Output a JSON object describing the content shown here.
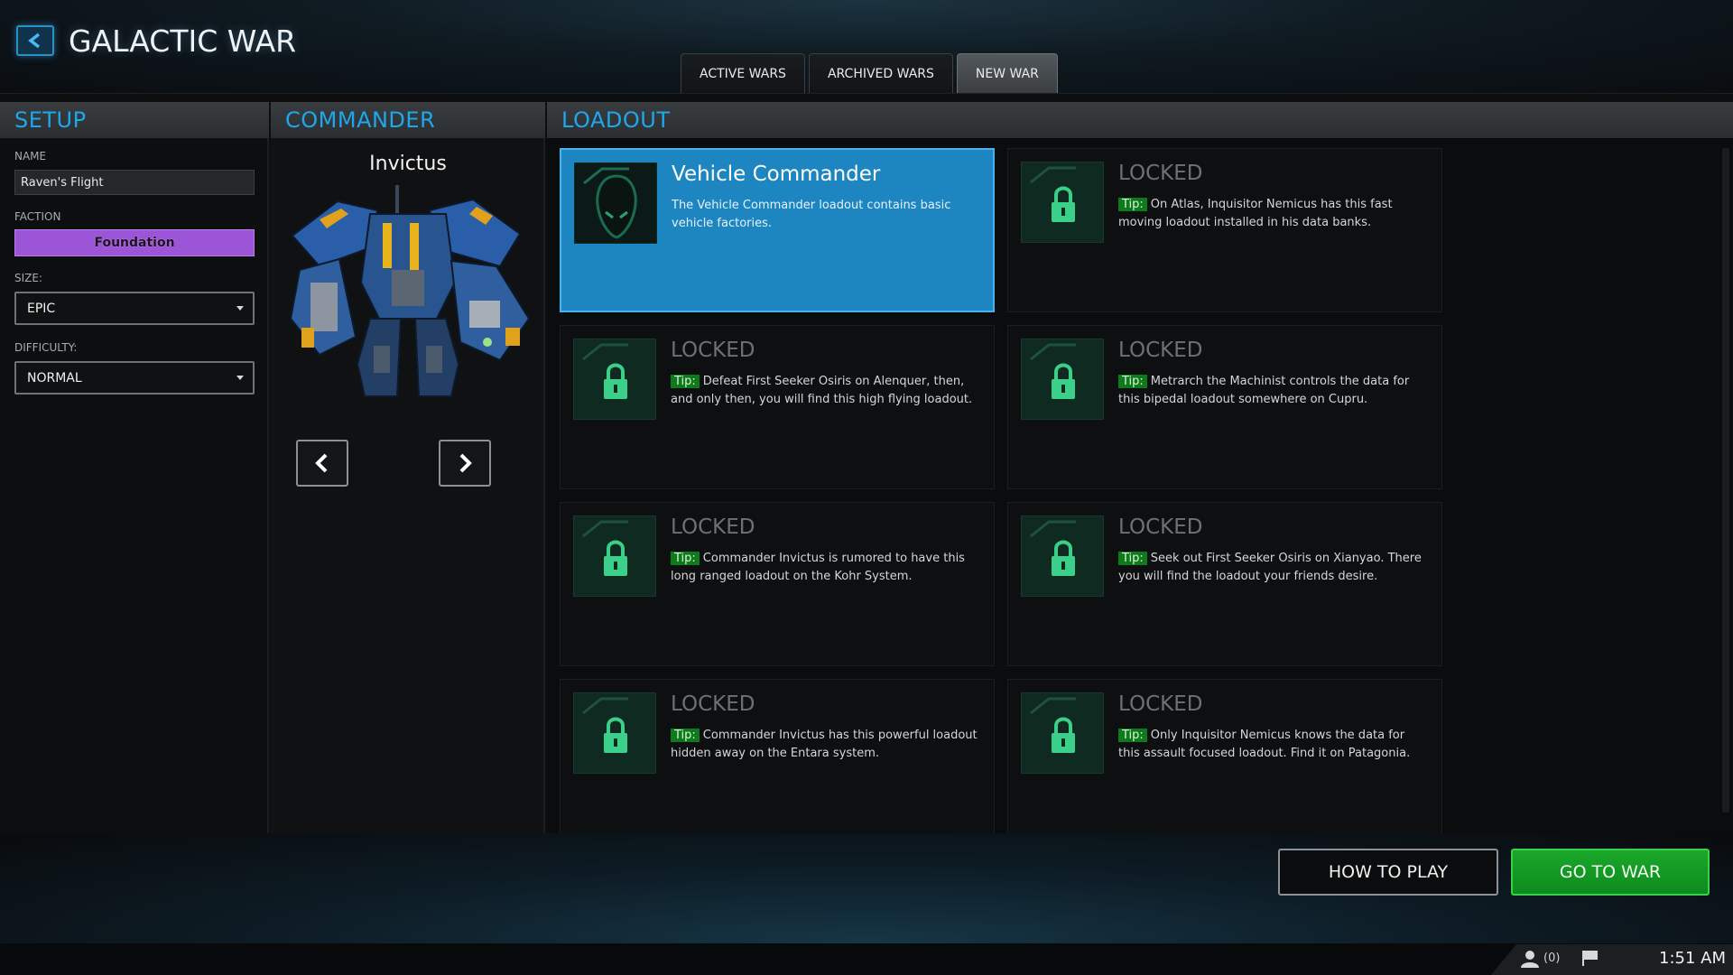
{
  "header": {
    "title": "GALACTIC WAR",
    "tabs": [
      {
        "label": "ACTIVE WARS"
      },
      {
        "label": "ARCHIVED WARS"
      },
      {
        "label": "NEW WAR"
      }
    ],
    "active_tab": "NEW WAR"
  },
  "setup": {
    "heading": "SETUP",
    "name_label": "NAME",
    "name_value": "Raven's Flight",
    "faction_label": "FACTION",
    "faction_value": "Foundation",
    "faction_color": "#9c55d6",
    "size_label": "SIZE:",
    "size_value": "EPIC",
    "difficulty_label": "DIFFICULTY:",
    "difficulty_value": "NORMAL"
  },
  "commander": {
    "heading": "COMMANDER",
    "name": "Invictus"
  },
  "loadout": {
    "heading": "LOADOUT",
    "tip_label": "Tip:",
    "cards": [
      {
        "title": "Vehicle Commander",
        "desc": "The Vehicle Commander loadout contains basic vehicle factories.",
        "locked": false,
        "selected": true
      },
      {
        "title": "LOCKED",
        "desc": "On Atlas, Inquisitor Nemicus has this fast moving loadout installed in his data banks.",
        "locked": true
      },
      {
        "title": "LOCKED",
        "desc": "Defeat First Seeker Osiris on Alenquer, then, and only then, you will find this high flying loadout.",
        "locked": true
      },
      {
        "title": "LOCKED",
        "desc": "Metrarch the Machinist controls the data for this bipedal loadout somewhere on Cupru.",
        "locked": true
      },
      {
        "title": "LOCKED",
        "desc": "Commander Invictus is rumored to have this long ranged loadout on the Kohr System.",
        "locked": true
      },
      {
        "title": "LOCKED",
        "desc": "Seek out First Seeker Osiris on Xianyao. There you will find the loadout your friends desire.",
        "locked": true
      },
      {
        "title": "LOCKED",
        "desc": "Commander Invictus has this powerful loadout hidden away on the Entara system.",
        "locked": true
      },
      {
        "title": "LOCKED",
        "desc": "Only Inquisitor Nemicus knows the data for this assault focused loadout. Find it on Patagonia.",
        "locked": true
      }
    ]
  },
  "footer": {
    "how_to_play": "HOW TO PLAY",
    "go_to_war": "GO TO WAR",
    "notification_count": "(0)",
    "clock": "1:51 AM"
  },
  "colors": {
    "accent": "#1fa7ec",
    "go_green": "#1aa82a",
    "selected_card": "#1d86c0",
    "lock_green": "#3ad08a"
  },
  "icons": [
    "back-arrow-icon",
    "chevron-left-icon",
    "chevron-right-icon",
    "lock-icon",
    "vehicle-commander-icon",
    "user-icon",
    "flag-icon",
    "chevron-down-icon"
  ]
}
